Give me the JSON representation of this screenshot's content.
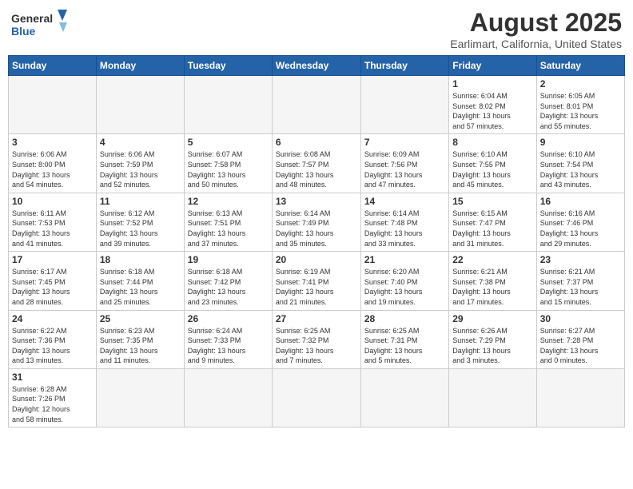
{
  "header": {
    "logo_general": "General",
    "logo_blue": "Blue",
    "month_title": "August 2025",
    "location": "Earlimart, California, United States"
  },
  "days_of_week": [
    "Sunday",
    "Monday",
    "Tuesday",
    "Wednesday",
    "Thursday",
    "Friday",
    "Saturday"
  ],
  "weeks": [
    [
      {
        "day": "",
        "empty": true
      },
      {
        "day": "",
        "empty": true
      },
      {
        "day": "",
        "empty": true
      },
      {
        "day": "",
        "empty": true
      },
      {
        "day": "",
        "empty": true
      },
      {
        "day": "1",
        "sunrise": "6:04 AM",
        "sunset": "8:02 PM",
        "daylight_h": "13",
        "daylight_m": "57"
      },
      {
        "day": "2",
        "sunrise": "6:05 AM",
        "sunset": "8:01 PM",
        "daylight_h": "13",
        "daylight_m": "55"
      }
    ],
    [
      {
        "day": "3",
        "sunrise": "6:06 AM",
        "sunset": "8:00 PM",
        "daylight_h": "13",
        "daylight_m": "54"
      },
      {
        "day": "4",
        "sunrise": "6:06 AM",
        "sunset": "7:59 PM",
        "daylight_h": "13",
        "daylight_m": "52"
      },
      {
        "day": "5",
        "sunrise": "6:07 AM",
        "sunset": "7:58 PM",
        "daylight_h": "13",
        "daylight_m": "50"
      },
      {
        "day": "6",
        "sunrise": "6:08 AM",
        "sunset": "7:57 PM",
        "daylight_h": "13",
        "daylight_m": "48"
      },
      {
        "day": "7",
        "sunrise": "6:09 AM",
        "sunset": "7:56 PM",
        "daylight_h": "13",
        "daylight_m": "47"
      },
      {
        "day": "8",
        "sunrise": "6:10 AM",
        "sunset": "7:55 PM",
        "daylight_h": "13",
        "daylight_m": "45"
      },
      {
        "day": "9",
        "sunrise": "6:10 AM",
        "sunset": "7:54 PM",
        "daylight_h": "13",
        "daylight_m": "43"
      }
    ],
    [
      {
        "day": "10",
        "sunrise": "6:11 AM",
        "sunset": "7:53 PM",
        "daylight_h": "13",
        "daylight_m": "41"
      },
      {
        "day": "11",
        "sunrise": "6:12 AM",
        "sunset": "7:52 PM",
        "daylight_h": "13",
        "daylight_m": "39"
      },
      {
        "day": "12",
        "sunrise": "6:13 AM",
        "sunset": "7:51 PM",
        "daylight_h": "13",
        "daylight_m": "37"
      },
      {
        "day": "13",
        "sunrise": "6:14 AM",
        "sunset": "7:49 PM",
        "daylight_h": "13",
        "daylight_m": "35"
      },
      {
        "day": "14",
        "sunrise": "6:14 AM",
        "sunset": "7:48 PM",
        "daylight_h": "13",
        "daylight_m": "33"
      },
      {
        "day": "15",
        "sunrise": "6:15 AM",
        "sunset": "7:47 PM",
        "daylight_h": "13",
        "daylight_m": "31"
      },
      {
        "day": "16",
        "sunrise": "6:16 AM",
        "sunset": "7:46 PM",
        "daylight_h": "13",
        "daylight_m": "29"
      }
    ],
    [
      {
        "day": "17",
        "sunrise": "6:17 AM",
        "sunset": "7:45 PM",
        "daylight_h": "13",
        "daylight_m": "28"
      },
      {
        "day": "18",
        "sunrise": "6:18 AM",
        "sunset": "7:44 PM",
        "daylight_h": "13",
        "daylight_m": "25"
      },
      {
        "day": "19",
        "sunrise": "6:18 AM",
        "sunset": "7:42 PM",
        "daylight_h": "13",
        "daylight_m": "23"
      },
      {
        "day": "20",
        "sunrise": "6:19 AM",
        "sunset": "7:41 PM",
        "daylight_h": "13",
        "daylight_m": "21"
      },
      {
        "day": "21",
        "sunrise": "6:20 AM",
        "sunset": "7:40 PM",
        "daylight_h": "13",
        "daylight_m": "19"
      },
      {
        "day": "22",
        "sunrise": "6:21 AM",
        "sunset": "7:38 PM",
        "daylight_h": "13",
        "daylight_m": "17"
      },
      {
        "day": "23",
        "sunrise": "6:21 AM",
        "sunset": "7:37 PM",
        "daylight_h": "13",
        "daylight_m": "15"
      }
    ],
    [
      {
        "day": "24",
        "sunrise": "6:22 AM",
        "sunset": "7:36 PM",
        "daylight_h": "13",
        "daylight_m": "13"
      },
      {
        "day": "25",
        "sunrise": "6:23 AM",
        "sunset": "7:35 PM",
        "daylight_h": "13",
        "daylight_m": "11"
      },
      {
        "day": "26",
        "sunrise": "6:24 AM",
        "sunset": "7:33 PM",
        "daylight_h": "13",
        "daylight_m": "9"
      },
      {
        "day": "27",
        "sunrise": "6:25 AM",
        "sunset": "7:32 PM",
        "daylight_h": "13",
        "daylight_m": "7"
      },
      {
        "day": "28",
        "sunrise": "6:25 AM",
        "sunset": "7:31 PM",
        "daylight_h": "13",
        "daylight_m": "5"
      },
      {
        "day": "29",
        "sunrise": "6:26 AM",
        "sunset": "7:29 PM",
        "daylight_h": "13",
        "daylight_m": "3"
      },
      {
        "day": "30",
        "sunrise": "6:27 AM",
        "sunset": "7:28 PM",
        "daylight_h": "13",
        "daylight_m": "0"
      }
    ],
    [
      {
        "day": "31",
        "sunrise": "6:28 AM",
        "sunset": "7:26 PM",
        "daylight_h": "12",
        "daylight_m": "58"
      },
      {
        "day": "",
        "empty": true
      },
      {
        "day": "",
        "empty": true
      },
      {
        "day": "",
        "empty": true
      },
      {
        "day": "",
        "empty": true
      },
      {
        "day": "",
        "empty": true
      },
      {
        "day": "",
        "empty": true
      }
    ]
  ],
  "labels": {
    "sunrise": "Sunrise:",
    "sunset": "Sunset:",
    "daylight": "Daylight:",
    "hours": "hours",
    "and": "and",
    "minutes": "minutes."
  }
}
